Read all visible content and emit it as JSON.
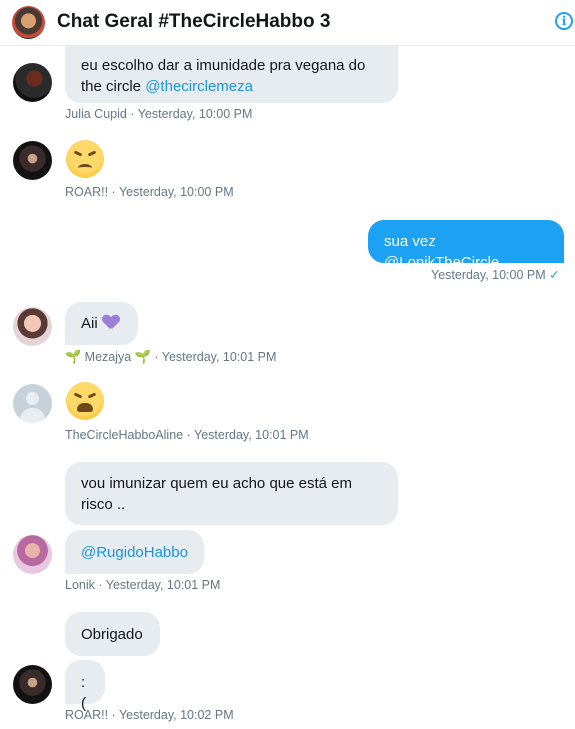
{
  "header": {
    "title": "Chat Geral #TheCircleHabbo 3",
    "info_icon": "info-icon"
  },
  "colors": {
    "accent": "#1da1f2",
    "mention": "#1b95e0",
    "bubble_in": "#e6ecf0",
    "meta_text": "#657786"
  },
  "messages": [
    {
      "text_before": "eu escolho dar a imunidade pra vegana do the circle ",
      "mention": "@thecirclemeza",
      "sender": "Julia Cupid",
      "time": "Yesterday, 10:00 PM"
    },
    {
      "emoji": "tired-face-emoji",
      "sender": "ROAR!!",
      "time": "Yesterday, 10:00 PM"
    },
    {
      "text": "sua vez @LonikTheCircle",
      "time": "Yesterday, 10:00 PM",
      "status_icon": "check-icon",
      "outgoing": true
    },
    {
      "text": "Aii",
      "emoji": "purple-heart-emoji",
      "sender": "Mezajya",
      "sender_decoration": "seedling-emoji",
      "time": "Yesterday, 10:01 PM"
    },
    {
      "emoji": "weary-face-emoji",
      "sender": "TheCircleHabboAline",
      "time": "Yesterday, 10:01 PM"
    },
    {
      "text": "vou imunizar quem eu acho que está em risco ..",
      "sender": "Lonik"
    },
    {
      "mention": "@RugidoHabbo",
      "sender": "Lonik",
      "time": "Yesterday, 10:01 PM"
    },
    {
      "text": "Obrigado",
      "sender": "ROAR!!"
    },
    {
      "text": ":(",
      "sender": "ROAR!!",
      "time": "Yesterday, 10:02 PM"
    }
  ]
}
